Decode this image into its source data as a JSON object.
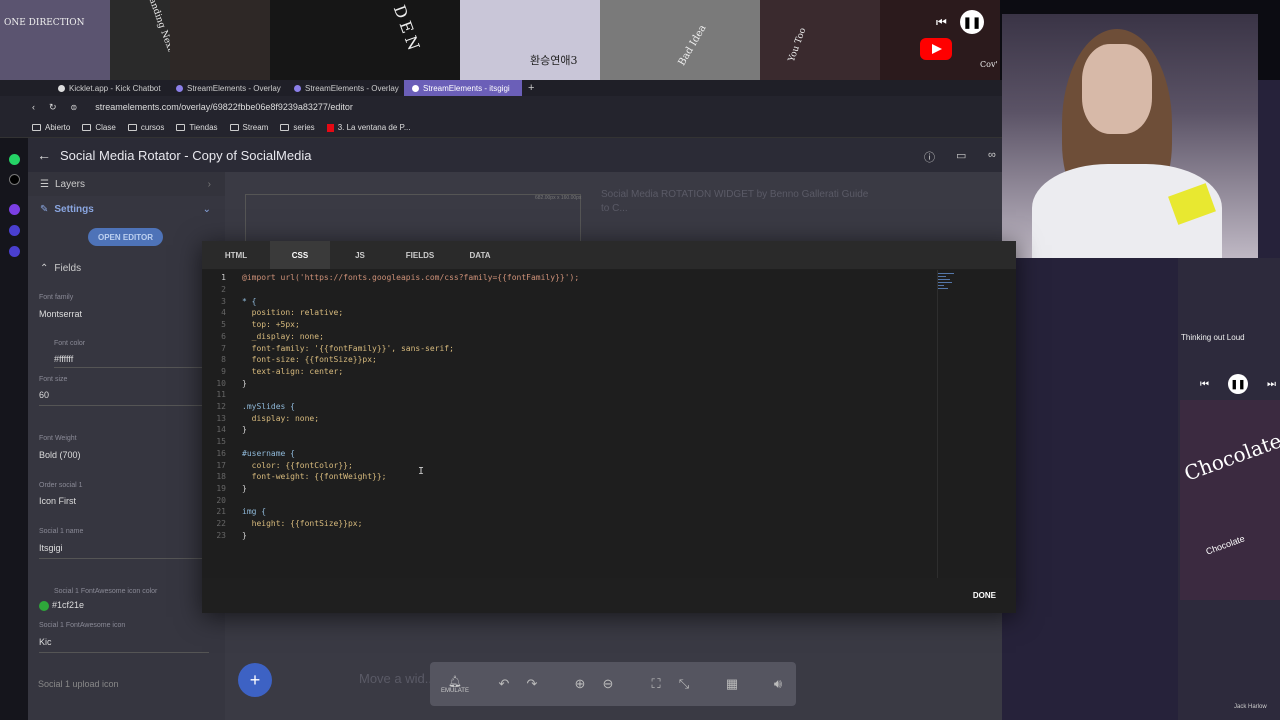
{
  "collage": {
    "tile1_text": "ONE DIRECTION",
    "tile2_text": "Standing Next to You",
    "tile3_text": "DEN",
    "tile4_text": "환승연애3",
    "tile5_text": "Bad Idea",
    "tile6_text": "You Too",
    "tile7_text": "Cov'",
    "youtube_icon": "youtube-icon"
  },
  "browser": {
    "tabs": [
      {
        "label": "Kicklet.app - Kick Chatbot"
      },
      {
        "label": "StreamElements - Overlay"
      },
      {
        "label": "StreamElements - Overlay"
      },
      {
        "label": "StreamElements - itsgigi"
      }
    ],
    "new_tab": "+",
    "url": "streamelements.com/overlay/69822fbbe06e8f9239a83277/editor",
    "bookmarks": [
      "Abierto",
      "Clase",
      "cursos",
      "Tiendas",
      "Stream",
      "series",
      "3. La ventana de P..."
    ]
  },
  "editor": {
    "title": "Social Media Rotator - Copy of SocialMedia"
  },
  "left_panel": {
    "layers_label": "Layers",
    "settings_label": "Settings",
    "open_editor_label": "OPEN EDITOR",
    "fields_label": "Fields",
    "fields": [
      {
        "label": "Font family",
        "value": "Montserrat"
      },
      {
        "label": "Font color",
        "value": "#ffffff"
      },
      {
        "label": "Font size",
        "value": "60"
      },
      {
        "label": "Font Weight",
        "value": "Bold (700)"
      },
      {
        "label": "Order social 1",
        "value": "Icon First"
      },
      {
        "label": "Social 1 name",
        "value": "Itsgigi"
      },
      {
        "label": "Social 1 FontAwesome icon color",
        "value": "#1cf21e"
      },
      {
        "label": "Social 1 FontAwesome icon",
        "value": "Kic"
      },
      {
        "label": "Social 1 upload icon",
        "value": ""
      }
    ]
  },
  "canvas": {
    "size_label": "682.00px x 160.00px",
    "ghost_text_1": "Social Media ROTATION WIDGET by Benno Gallerati Guide to C...",
    "ghost_text_2": "Move a wid...",
    "ghost_text_3": "Thinking out Loud"
  },
  "bottombar": {
    "emulate_label": "EMULATE"
  },
  "modal": {
    "tabs": [
      "HTML",
      "CSS",
      "JS",
      "FIELDS",
      "DATA"
    ],
    "active_tab": "CSS",
    "done_label": "DONE",
    "code_lines": [
      "@import url('https://fonts.googleapis.com/css?family={{fontFamily}}');",
      "",
      "* {",
      "  position: relative;",
      "  top: +5px;",
      "  _display: none;",
      "  font-family: '{{fontFamily}}', sans-serif;",
      "  font-size: {{fontSize}}px;",
      "  text-align: center;",
      "}",
      "",
      ".mySlides {",
      "  display: none;",
      "}",
      "",
      "#username {",
      "  color: {{fontColor}};",
      "  font-weight: {{fontWeight}};",
      "}",
      "",
      "img {",
      "  height: {{fontSize}}px;",
      "}"
    ]
  },
  "now_playing": {
    "title": "Thinking out Loud",
    "album_word": "Chocolate",
    "album_small": "Chocolate",
    "credit": "Jack Harlow"
  },
  "colors": {
    "accent": "#4e73b8",
    "active_tab": "#6b5fb8",
    "icon_color_swatch": "#2ea83a"
  }
}
